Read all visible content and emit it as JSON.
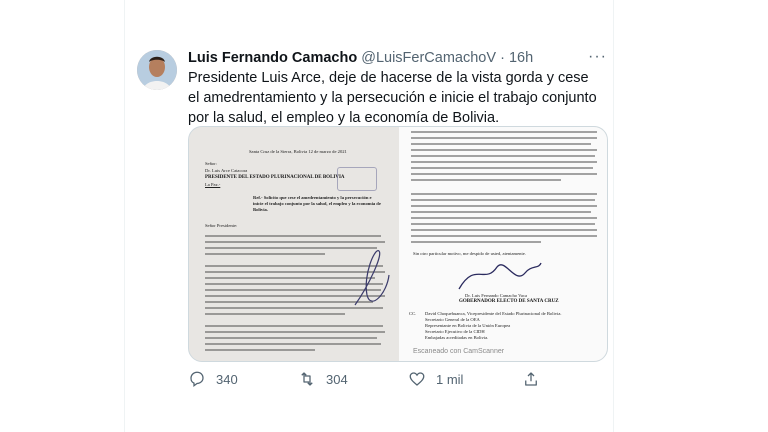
{
  "tweet": {
    "author_name": "Luis Fernando Camacho",
    "author_handle": "@LuisFerCamachoV",
    "separator": "·",
    "time": "16h",
    "text": "Presidente Luis Arce, deje de hacerse de la vista gorda y cese el amedrentamiento y la persecución e inicie el trabajo conjunto por la salud, el empleo y la economía de Bolivia.",
    "more_icon": "more-horizontal-icon"
  },
  "media": {
    "left_page": {
      "date": "Santa Cruz de la Sierra, Bolivia 12 de marzo de 2021",
      "recipient_1": "Señor:",
      "recipient_2": "Dr. Luis Arce Catacora",
      "recipient_3": "PRESIDENTE DEL ESTADO PLURINACIONAL DE BOLIVIA",
      "recipient_4": "La Paz.-",
      "ref": "Ref.- Solicito que cese el amedrentamiento y la persecución e inicie el trabajo conjunto por la salud, el empleo y la economía de Bolivia.",
      "salutation": "Señor Presidente:"
    },
    "right_page": {
      "closing": "Sin otro particular motivo, me despido de usted, atentamente.",
      "signer_name": "Dr. Luis Fernando Camacho Vaca",
      "signer_title": "GOBERNADOR ELECTO DE SANTA CRUZ",
      "cc_label": "CC.",
      "cc_1": "David Choquehuanca, Vicepresidente del Estado Plurinacional de Bolivia.",
      "cc_2": "Secretario General de la OEA",
      "cc_3": "Representante en Bolivia de la Unión Europea",
      "cc_4": "Secretario Ejecutivo de la CIDH",
      "cc_5": "Embajadas acreditadas en Bolivia.",
      "watermark": "Escaneado con CamScanner"
    }
  },
  "actions": {
    "reply_count": "340",
    "retweet_count": "304",
    "like_count": "1 mil",
    "reply_icon": "reply-icon",
    "retweet_icon": "retweet-icon",
    "like_icon": "heart-icon",
    "share_icon": "share-icon"
  },
  "colors": {
    "text": "#0f1419",
    "secondary": "#536471",
    "border": "#cfd9de"
  }
}
